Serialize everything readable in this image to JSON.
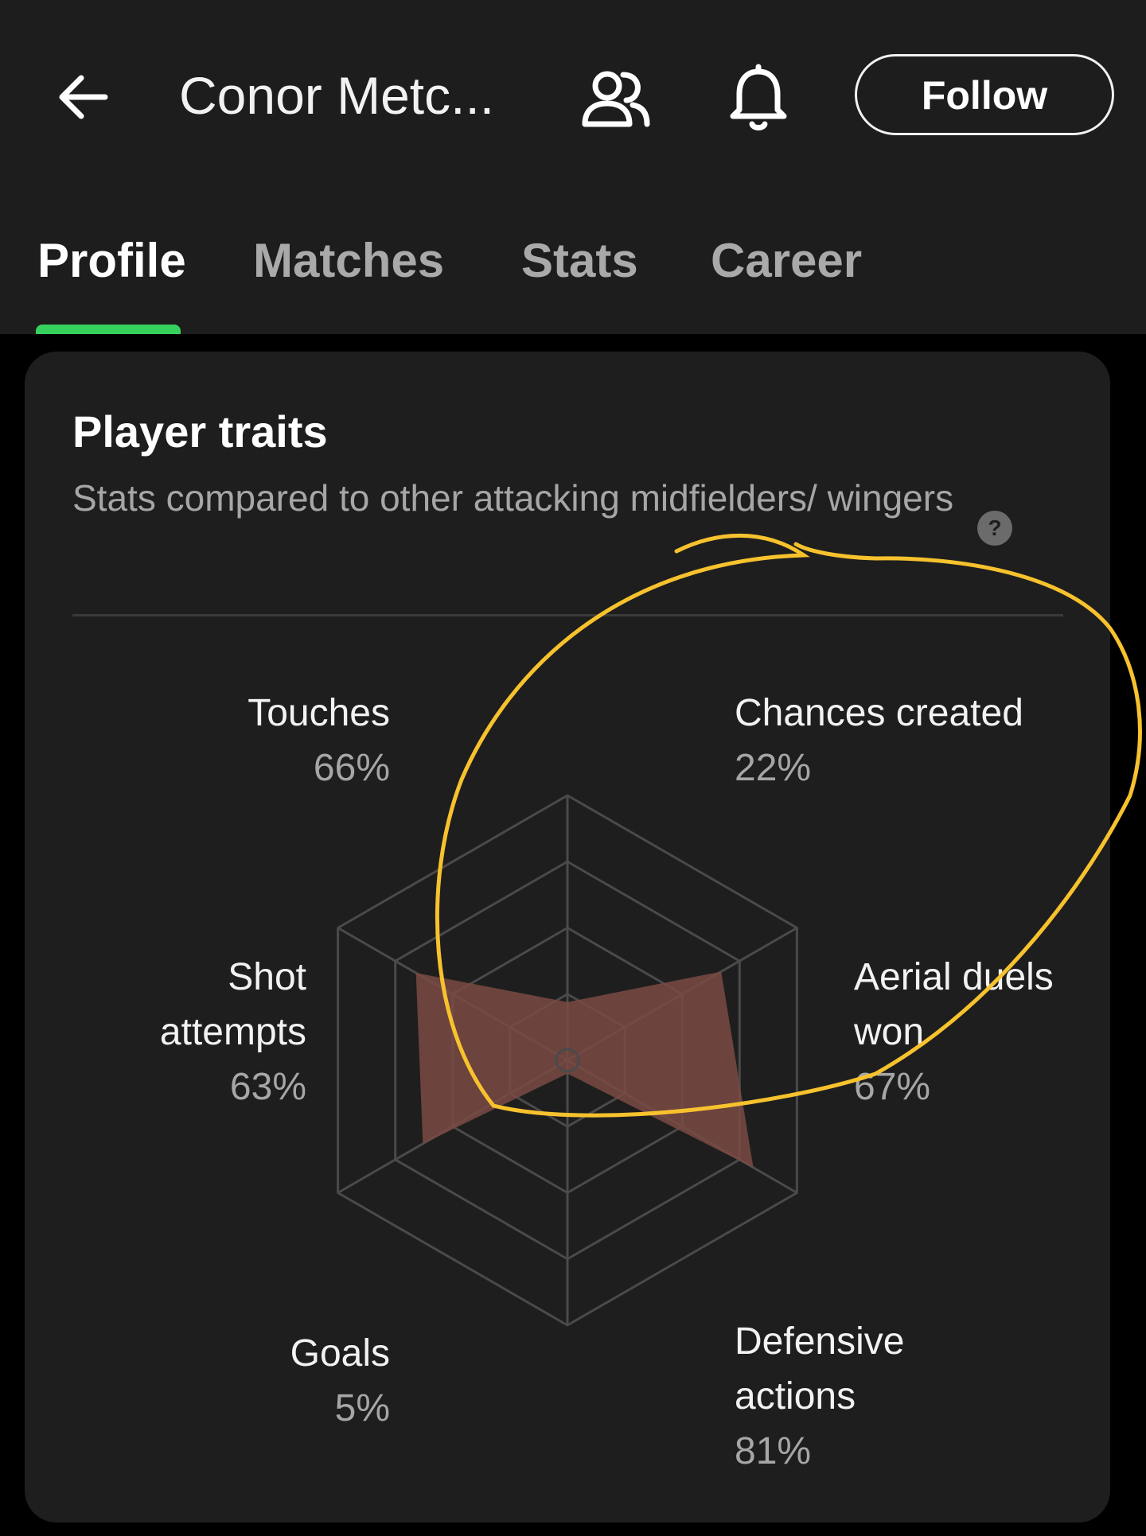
{
  "header": {
    "player_name": "Conor Metc...",
    "follow_label": "Follow",
    "icons": [
      "back-arrow-icon",
      "squad-icon",
      "bell-icon"
    ]
  },
  "tabs": [
    {
      "label": "Profile",
      "active": true
    },
    {
      "label": "Matches",
      "active": false
    },
    {
      "label": "Stats",
      "active": false
    },
    {
      "label": "Career",
      "active": false
    }
  ],
  "traits_card": {
    "title": "Player traits",
    "subtitle": "Stats compared to other attacking midfielders/ wingers",
    "help_icon": "question-circle-icon",
    "items": [
      {
        "name": "Touches",
        "value": "66%"
      },
      {
        "name": "Chances created",
        "value": "22%"
      },
      {
        "name": "Aerial duels won",
        "value": "67%"
      },
      {
        "name": "Defensive actions",
        "value": "81%"
      },
      {
        "name": "Goals",
        "value": "5%"
      },
      {
        "name": "Shot attempts",
        "value": "63%"
      }
    ]
  },
  "chart_data": {
    "type": "radar",
    "axes": [
      "Chances created",
      "Aerial duels won",
      "Defensive actions",
      "Goals",
      "Shot attempts",
      "Touches"
    ],
    "values": [
      22,
      67,
      81,
      5,
      63,
      66
    ],
    "max": 100,
    "grid_rings": 4,
    "fill_color": "#7a4a43",
    "grid_color": "#4a4a4a"
  },
  "colors": {
    "accent": "#36d15c",
    "annotation": "#f7c22d"
  }
}
